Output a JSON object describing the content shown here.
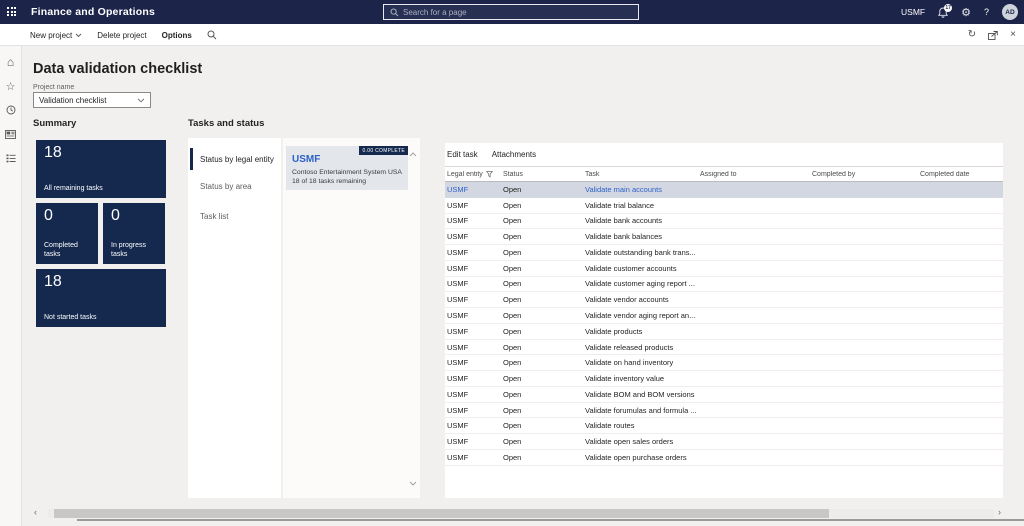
{
  "header": {
    "app_title": "Finance and Operations",
    "search_placeholder": "Search for a page",
    "company": "USMF",
    "notification_count": "17",
    "help_label": "?",
    "avatar_initials": "AD"
  },
  "action_bar": {
    "new_project": "New project",
    "delete_project": "Delete project",
    "options": "Options"
  },
  "page": {
    "title": "Data validation checklist",
    "project_name_label": "Project name",
    "project_name_value": "Validation checklist"
  },
  "summary": {
    "heading": "Summary",
    "tiles": [
      {
        "count": "18",
        "label": "All remaining tasks",
        "size": "wide"
      },
      {
        "count": "0",
        "label": "Completed tasks",
        "size": "half"
      },
      {
        "count": "0",
        "label": "In progress tasks",
        "size": "half"
      },
      {
        "count": "18",
        "label": "Not started tasks",
        "size": "wide"
      }
    ]
  },
  "tasks_section": {
    "heading": "Tasks and status",
    "tabs": [
      {
        "label": "Status by legal entity",
        "selected": true
      },
      {
        "label": "Status by area",
        "selected": false
      },
      {
        "label": "Task list",
        "selected": false
      }
    ],
    "entity_card": {
      "badge": "0.00 COMPLETE",
      "title": "USMF",
      "subtitle": "Contoso Entertainment System USA",
      "remaining": "18 of 18 tasks remaining"
    }
  },
  "task_table": {
    "toolbar": {
      "edit_task": "Edit task",
      "attachments": "Attachments"
    },
    "columns": [
      "Legal entity",
      "Status",
      "Task",
      "Assigned to",
      "Completed by",
      "Completed date"
    ],
    "selected_row_index": 0,
    "rows": [
      {
        "legal_entity": "USMF",
        "status": "Open",
        "task": "Validate main accounts"
      },
      {
        "legal_entity": "USMF",
        "status": "Open",
        "task": "Validate trial balance"
      },
      {
        "legal_entity": "USMF",
        "status": "Open",
        "task": "Validate bank accounts"
      },
      {
        "legal_entity": "USMF",
        "status": "Open",
        "task": "Validate bank balances"
      },
      {
        "legal_entity": "USMF",
        "status": "Open",
        "task": "Validate outstanding bank trans..."
      },
      {
        "legal_entity": "USMF",
        "status": "Open",
        "task": "Validate customer accounts"
      },
      {
        "legal_entity": "USMF",
        "status": "Open",
        "task": "Validate customer aging report ..."
      },
      {
        "legal_entity": "USMF",
        "status": "Open",
        "task": "Validate vendor accounts"
      },
      {
        "legal_entity": "USMF",
        "status": "Open",
        "task": "Validate vendor aging report an..."
      },
      {
        "legal_entity": "USMF",
        "status": "Open",
        "task": "Validate products"
      },
      {
        "legal_entity": "USMF",
        "status": "Open",
        "task": "Validate released products"
      },
      {
        "legal_entity": "USMF",
        "status": "Open",
        "task": "Validate on hand inventory"
      },
      {
        "legal_entity": "USMF",
        "status": "Open",
        "task": "Validate inventory value"
      },
      {
        "legal_entity": "USMF",
        "status": "Open",
        "task": "Validate BOM and BOM versions"
      },
      {
        "legal_entity": "USMF",
        "status": "Open",
        "task": "Validate forumulas and formula ..."
      },
      {
        "legal_entity": "USMF",
        "status": "Open",
        "task": "Validate routes"
      },
      {
        "legal_entity": "USMF",
        "status": "Open",
        "task": "Validate open sales orders"
      },
      {
        "legal_entity": "USMF",
        "status": "Open",
        "task": "Validate open purchase orders"
      }
    ]
  },
  "icons": {
    "hamburger": "≡",
    "home": "⌂",
    "star": "☆",
    "gear": "⚙",
    "refresh": "↻",
    "close": "×",
    "scroll_left": "‹",
    "scroll_right": "›"
  },
  "colors": {
    "header_bg": "#1c2549",
    "tile_bg": "#15294f",
    "link_blue": "#2e62c9",
    "selected_row": "#d3d7e1",
    "card_bg": "#e3e6eb",
    "badge_bg": "#15294f",
    "page_bg": "#f1f0ee"
  }
}
